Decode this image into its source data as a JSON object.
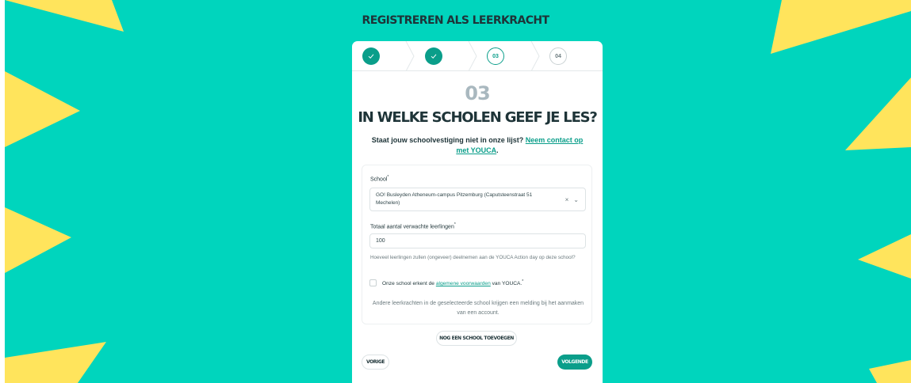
{
  "page": {
    "title": "REGISTREREN ALS LEERKRACHT"
  },
  "colors": {
    "background": "#00d5bd",
    "accent": "#0a9e8a",
    "decor": "#ffe45c",
    "text": "#1e3438"
  },
  "stepper": {
    "steps": [
      {
        "state": "done",
        "icon": "check-icon"
      },
      {
        "state": "done",
        "icon": "check-icon"
      },
      {
        "state": "current",
        "label": "03"
      },
      {
        "state": "upcoming",
        "label": "04"
      }
    ]
  },
  "step": {
    "number": "03",
    "title": "IN WELKE SCHOLEN GEEF JE LES?",
    "subtitle_text": "Staat jouw schoolvestiging niet in onze lijst?",
    "subtitle_link": "Neem contact op met YOUCA",
    "subtitle_end": "."
  },
  "form": {
    "school_label": "School",
    "required_mark": "*",
    "school_value": "GO! Busleyden Atheneum-campus Pitzemburg (Caputsteenstraat 51 Mechelen)",
    "clear_icon": "×",
    "dropdown_icon": "⌄",
    "students_label": "Totaal aantal verwachte leerlingen",
    "students_value": "100",
    "students_hint": "Hoeveel leerlingen zullen (ongeveer) deelnemen aan de YOUCA Action day op deze school?",
    "terms_pre": "Onze school erkent de",
    "terms_link": "algemene voorwaarden",
    "terms_post": "van YOUCA.",
    "note": "Andere leerkrachten in de geselecteerde school krijgen een melding bij het aanmaken van een account."
  },
  "buttons": {
    "add_school": "NOG EEN SCHOOL TOEVOEGEN",
    "previous": "VORIGE",
    "next": "VOLGENDE"
  }
}
